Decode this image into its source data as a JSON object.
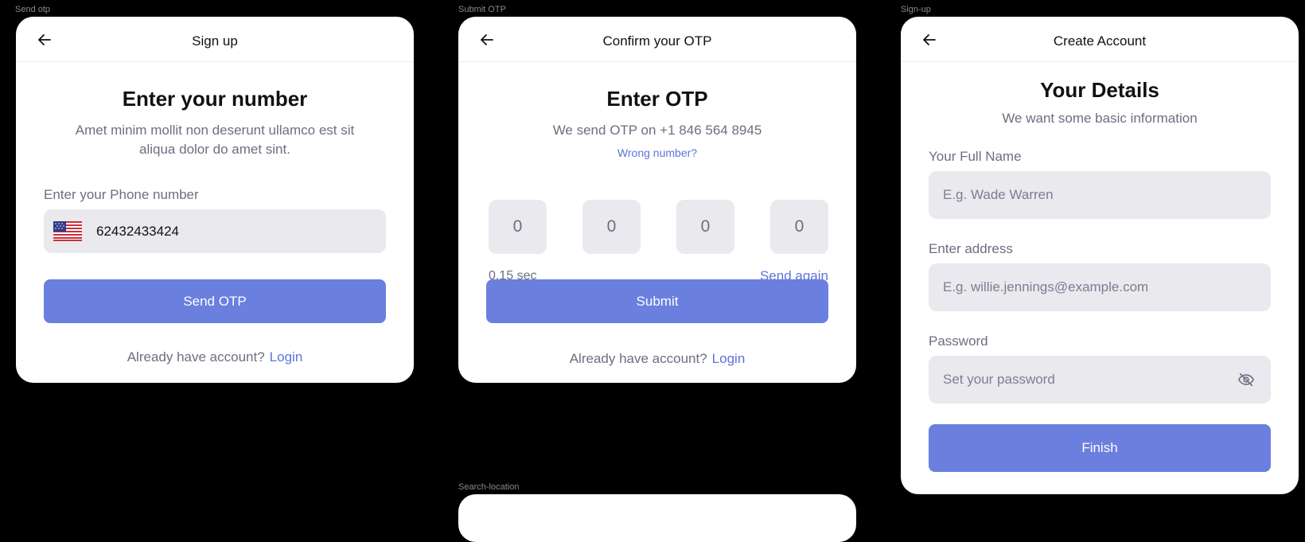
{
  "frames": {
    "send_otp": {
      "frame_label": "Send otp",
      "header_title": "Sign up",
      "heading": "Enter your number",
      "description_line1": "Amet minim mollit non deserunt ullamco est sit",
      "description_line2": "aliqua dolor do amet sint.",
      "phone_label": "Enter your Phone number",
      "phone_value": "62432433424",
      "send_button": "Send OTP",
      "footer_text": "Already have account?",
      "login_link": "Login"
    },
    "submit_otp": {
      "frame_label": "Submit OTP",
      "header_title": "Confirm your OTP",
      "heading": "Enter OTP",
      "description": "We send OTP on +1 846 564 8945",
      "wrong_number_link": "Wrong number?",
      "otp_digits": [
        "0",
        "0",
        "0",
        "0"
      ],
      "timer": "0.15 sec",
      "send_again_link": "Send again",
      "submit_button": "Submit",
      "footer_text": "Already have account?",
      "login_link": "Login"
    },
    "sign_up": {
      "frame_label": "Sign-up",
      "header_title": "Create Account",
      "heading": "Your Details",
      "subheading": "We want some basic information",
      "full_name_label": "Your Full Name",
      "full_name_placeholder": "E.g. Wade Warren",
      "address_label": "Enter address",
      "address_placeholder": "E.g. willie.jennings@example.com",
      "password_label": "Password",
      "password_placeholder": "Set your password",
      "finish_button": "Finish"
    },
    "search_location": {
      "frame_label": "Search-location"
    }
  },
  "icons": {
    "back": "arrow-left-icon",
    "flag": "us-flag-icon",
    "password_toggle": "eye-off-icon"
  },
  "colors": {
    "background": "#000000",
    "card": "#ffffff",
    "accent": "#6a7fde",
    "link": "#5f74d6",
    "field": "#e9e9ee",
    "muted_text": "#6b6f80"
  }
}
